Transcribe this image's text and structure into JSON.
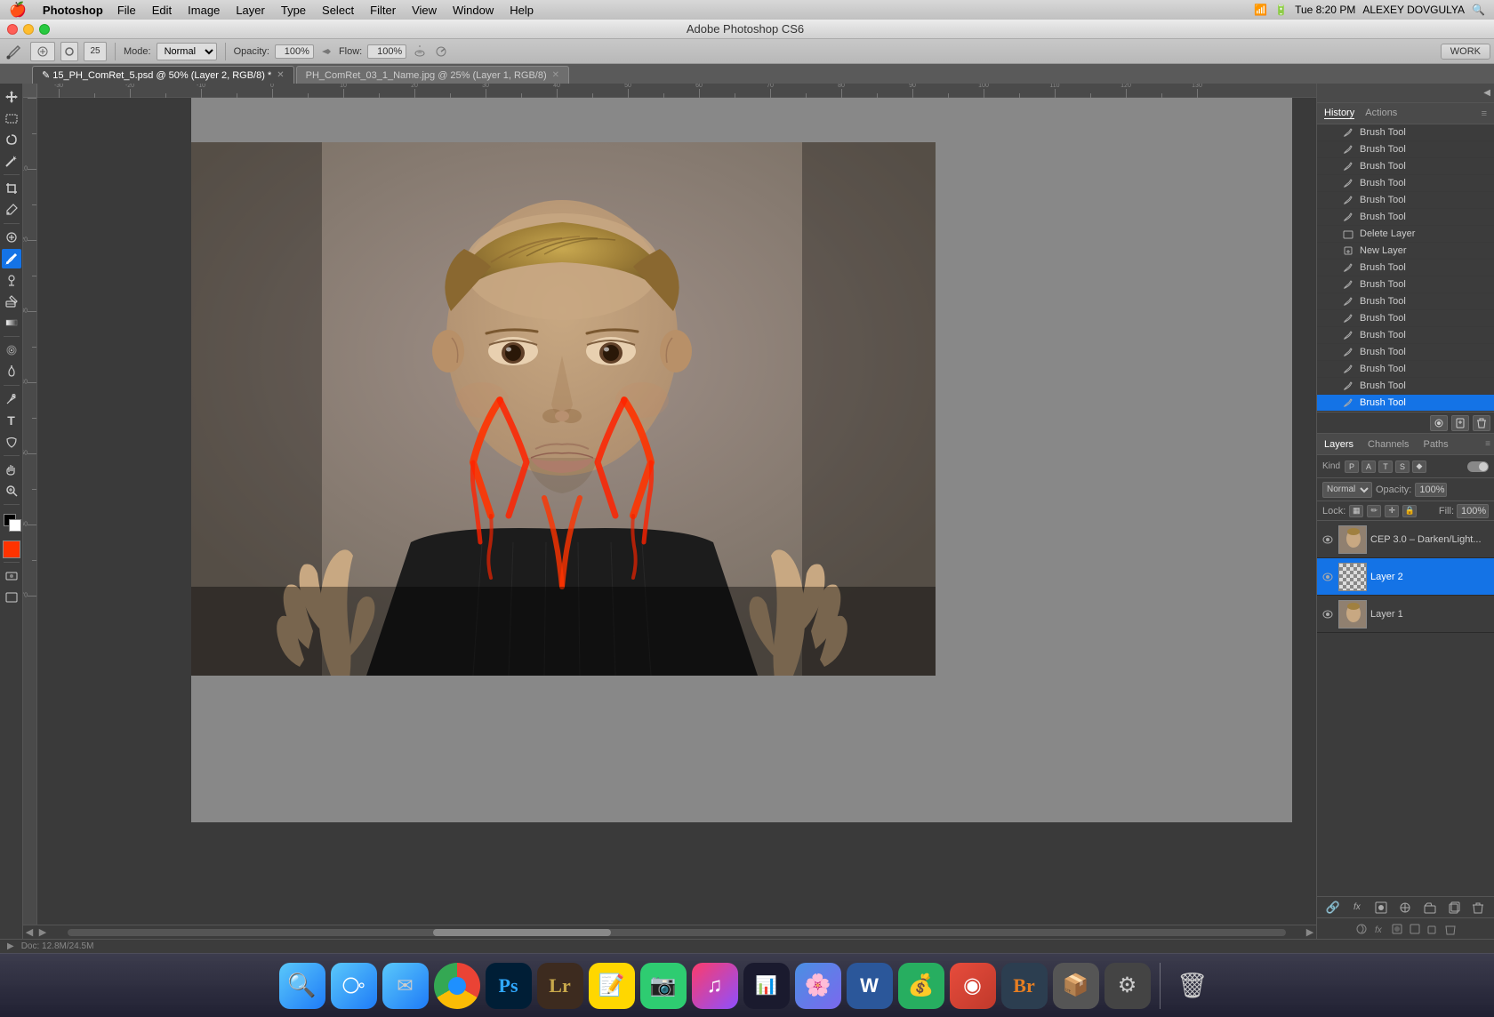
{
  "app": {
    "title": "Adobe Photoshop CS6",
    "name": "Photoshop"
  },
  "menubar": {
    "apple": "🍎",
    "app_name": "Photoshop",
    "menus": [
      "File",
      "Edit",
      "Image",
      "Layer",
      "Type",
      "Select",
      "Filter",
      "View",
      "Window",
      "Help"
    ],
    "right": {
      "battery": "100%",
      "time": "Tue 8:20 PM",
      "user": "ALEXEY DOVGULYA"
    }
  },
  "window": {
    "title": "Adobe Photoshop CS6"
  },
  "optionsbar": {
    "mode_label": "Mode:",
    "mode_value": "Normal",
    "opacity_label": "Opacity:",
    "opacity_value": "100%",
    "flow_label": "Flow:",
    "flow_value": "100%",
    "work_label": "WORK"
  },
  "tabs": [
    {
      "label": "15_PH_ComRet_5.psd @ 50% (Layer 2, RGB/8)",
      "active": true,
      "modified": true
    },
    {
      "label": "PH_ComRet_03_1_Name.jpg @ 25% (Layer 1, RGB/8)",
      "active": false,
      "modified": false
    }
  ],
  "toolbar": {
    "tools": [
      {
        "name": "move",
        "icon": "✛"
      },
      {
        "name": "marquee",
        "icon": "⬜"
      },
      {
        "name": "lasso",
        "icon": "⌾"
      },
      {
        "name": "magic-wand",
        "icon": "✦"
      },
      {
        "name": "crop",
        "icon": "⊞"
      },
      {
        "name": "eyedropper",
        "icon": "✒"
      },
      {
        "name": "healing",
        "icon": "✚"
      },
      {
        "name": "brush",
        "icon": "🖌"
      },
      {
        "name": "clone",
        "icon": "⊙"
      },
      {
        "name": "eraser",
        "icon": "◻"
      },
      {
        "name": "gradient",
        "icon": "▣"
      },
      {
        "name": "blur",
        "icon": "◉"
      },
      {
        "name": "dodge",
        "icon": "⊗"
      },
      {
        "name": "pen",
        "icon": "✏"
      },
      {
        "name": "text",
        "icon": "T"
      },
      {
        "name": "path",
        "icon": "◈"
      },
      {
        "name": "shape",
        "icon": "◱"
      },
      {
        "name": "hand",
        "icon": "✋"
      },
      {
        "name": "zoom",
        "icon": "🔍"
      }
    ]
  },
  "history": {
    "panel_title": "History",
    "actions_title": "Actions",
    "items": [
      {
        "label": "Brush Tool",
        "icon": "brush",
        "checked": false,
        "active": false
      },
      {
        "label": "Brush Tool",
        "icon": "brush",
        "checked": false,
        "active": false
      },
      {
        "label": "Brush Tool",
        "icon": "brush",
        "checked": false,
        "active": false
      },
      {
        "label": "Brush Tool",
        "icon": "brush",
        "checked": false,
        "active": false
      },
      {
        "label": "Brush Tool",
        "icon": "brush",
        "checked": false,
        "active": false
      },
      {
        "label": "Brush Tool",
        "icon": "brush",
        "checked": false,
        "active": false
      },
      {
        "label": "Delete Layer",
        "icon": "delete",
        "checked": false,
        "active": false
      },
      {
        "label": "New Layer",
        "icon": "new",
        "checked": false,
        "active": false
      },
      {
        "label": "Brush Tool",
        "icon": "brush",
        "checked": false,
        "active": false
      },
      {
        "label": "Brush Tool",
        "icon": "brush",
        "checked": false,
        "active": false
      },
      {
        "label": "Brush Tool",
        "icon": "brush",
        "checked": false,
        "active": false
      },
      {
        "label": "Brush Tool",
        "icon": "brush",
        "checked": false,
        "active": false
      },
      {
        "label": "Brush Tool",
        "icon": "brush",
        "checked": false,
        "active": false
      },
      {
        "label": "Brush Tool",
        "icon": "brush",
        "checked": false,
        "active": false
      },
      {
        "label": "Brush Tool",
        "icon": "brush",
        "checked": false,
        "active": false
      },
      {
        "label": "Brush Tool",
        "icon": "brush",
        "checked": false,
        "active": false
      },
      {
        "label": "Brush Tool",
        "icon": "brush",
        "checked": false,
        "active": true
      }
    ]
  },
  "layers": {
    "panel_title": "Layers",
    "channels_label": "Channels",
    "paths_label": "Paths",
    "blend_mode": "Normal",
    "opacity_label": "Opacity:",
    "opacity_value": "100%",
    "fill_label": "Fill:",
    "fill_value": "100%",
    "lock_label": "Lock:",
    "items": [
      {
        "name": "CEP 3.0 – Darken/Light...",
        "visible": true,
        "active": false,
        "type": "photo"
      },
      {
        "name": "Layer 2",
        "visible": true,
        "active": true,
        "type": "checker"
      },
      {
        "name": "Layer 1",
        "visible": true,
        "active": false,
        "type": "photo"
      }
    ]
  },
  "dock": {
    "icons": [
      {
        "name": "finder",
        "label": "Finder",
        "color": "#4a90e2"
      },
      {
        "name": "safari",
        "label": "Safari",
        "color": "#5ac8fa"
      },
      {
        "name": "mail",
        "label": "Mail",
        "color": "#4a90e2"
      },
      {
        "name": "chrome",
        "label": "Chrome",
        "color": "#4caf50"
      },
      {
        "name": "photoshop",
        "label": "Photoshop",
        "color": "#001e36"
      },
      {
        "name": "lightroom",
        "label": "Lightroom",
        "color": "#3d2b1f"
      },
      {
        "name": "stickies",
        "label": "Stickies",
        "color": "#ffd700"
      },
      {
        "name": "facetime",
        "label": "FaceTime",
        "color": "#2ecc71"
      },
      {
        "name": "itunes",
        "label": "iTunes",
        "color": "#fc3c6b"
      },
      {
        "name": "istat",
        "label": "iStat Menus",
        "color": "#555"
      },
      {
        "name": "iphoto",
        "label": "iPhoto",
        "color": "#4a90e2"
      },
      {
        "name": "word",
        "label": "Word",
        "color": "#2b579a"
      },
      {
        "name": "moneymoney",
        "label": "MoneyMoney",
        "color": "#27ae60"
      },
      {
        "name": "app2",
        "label": "App",
        "color": "#e74c3c"
      },
      {
        "name": "bridge",
        "label": "Bridge",
        "color": "#2c3e50"
      },
      {
        "name": "app3",
        "label": "App",
        "color": "#555"
      },
      {
        "name": "app4",
        "label": "App",
        "color": "#555"
      },
      {
        "name": "trash",
        "label": "Trash",
        "color": "#888"
      }
    ]
  },
  "statusbar": {
    "text": "Doc: 12.8M/24.5M"
  }
}
